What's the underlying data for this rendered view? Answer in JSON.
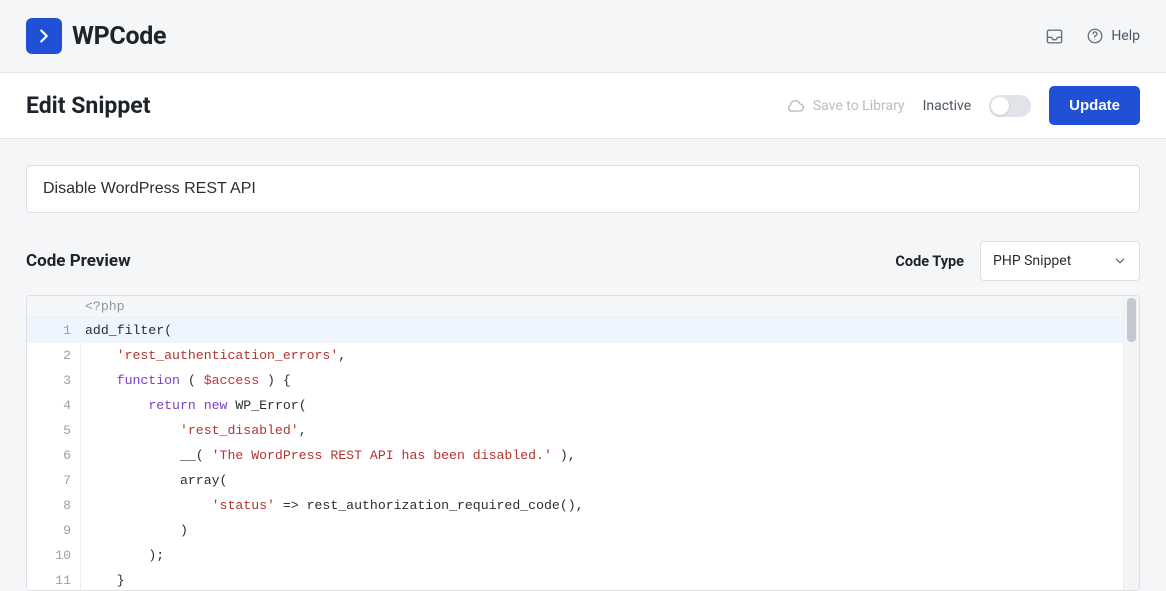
{
  "appbar": {
    "brand_name": "WPCode",
    "help_label": "Help"
  },
  "pagebar": {
    "title": "Edit Snippet",
    "save_library_label": "Save to Library",
    "status_label": "Inactive",
    "toggle_on": false,
    "update_label": "Update"
  },
  "snippet": {
    "title_value": "Disable WordPress REST API"
  },
  "section": {
    "preview_heading": "Code Preview",
    "code_type_label": "Code Type",
    "code_type_value": "PHP Snippet"
  },
  "editor": {
    "php_open": "<?php",
    "lines": {
      "l1": {
        "t1": "add_filter("
      },
      "l2": {
        "indent": "    ",
        "str": "'rest_authentication_errors'",
        "tail": ","
      },
      "l3": {
        "indent": "    ",
        "kw": "function",
        "t1": " ( ",
        "var": "$access",
        "t2": " ) {"
      },
      "l4": {
        "indent": "        ",
        "kw1": "return",
        "sp": " ",
        "kw2": "new",
        "t1": " WP_Error("
      },
      "l5": {
        "indent": "            ",
        "str": "'rest_disabled'",
        "tail": ","
      },
      "l6": {
        "indent": "            ",
        "t1": "__( ",
        "str": "'The WordPress REST API has been disabled.'",
        "t2": " ),"
      },
      "l7": {
        "indent": "            ",
        "t1": "array("
      },
      "l8": {
        "indent": "                ",
        "str": "'status'",
        "t1": " => rest_authorization_required_code(),"
      },
      "l9": {
        "indent": "            ",
        "t1": ")"
      },
      "l10": {
        "indent": "        ",
        "t1": ");"
      },
      "l11": {
        "indent": "    ",
        "t1": "}"
      }
    },
    "line_numbers": [
      "1",
      "2",
      "3",
      "4",
      "5",
      "6",
      "7",
      "8",
      "9",
      "10",
      "11"
    ]
  }
}
